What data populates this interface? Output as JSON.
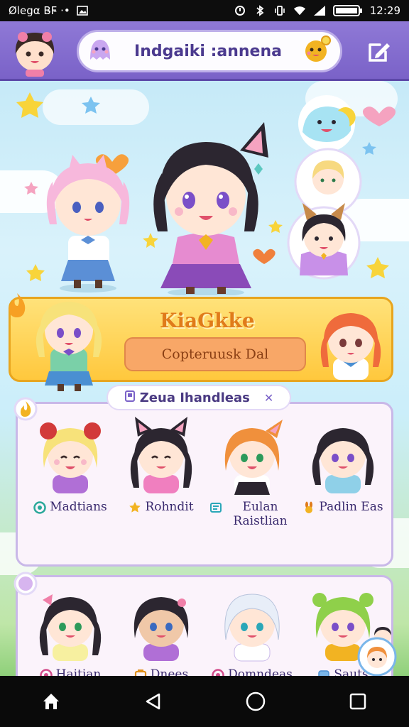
{
  "status_bar": {
    "left_text": "Ølegα Β̵F̵ ·•",
    "time": "12:29"
  },
  "header": {
    "title": "Indgaiki :annena",
    "edit_icon": "edit-icon"
  },
  "banner": {
    "title": "KiaGkke",
    "bubble_text": "Copteruusk Dal"
  },
  "section": {
    "tab_label": "Zeua Ihandleas",
    "tab_close": "✕"
  },
  "grid_row1": [
    {
      "label": "Madtians",
      "icon": "teal-circle-icon",
      "icon_color": "#2aa89a"
    },
    {
      "label": "Rohndit",
      "icon": "star-icon",
      "icon_color": "#f2b322"
    },
    {
      "label": "Eulan Raistlian",
      "icon": "card-icon",
      "icon_color": "#2aa7b8"
    },
    {
      "label": "Padlin Eas",
      "icon": "bunny-icon",
      "icon_color": "#e07b1a"
    }
  ],
  "grid_row2": [
    {
      "label": "Haitian",
      "icon": "pink-circle-icon",
      "icon_color": "#d24b8a"
    },
    {
      "label": "Dnees",
      "icon": "box-icon",
      "icon_color": "#e0901a"
    },
    {
      "label": "Domndeas",
      "icon": "pink-circle-icon",
      "icon_color": "#d24b8a"
    },
    {
      "label": "Sauts",
      "icon": "blue-box-icon",
      "icon_color": "#4a8fd2"
    }
  ],
  "colors": {
    "topbar": "#7a62c8",
    "banner": "#ffc83d",
    "panel_border": "#c9b8e8",
    "title_text": "#4b3a8f"
  }
}
